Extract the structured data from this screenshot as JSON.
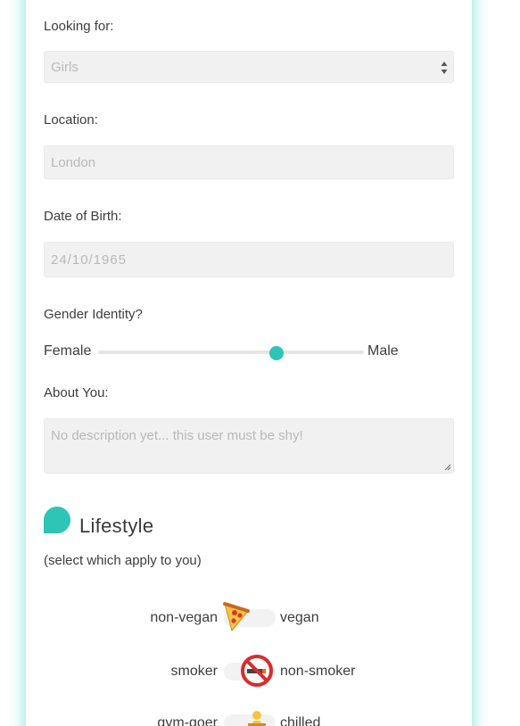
{
  "form": {
    "looking_for": {
      "label": "Looking for:",
      "value": "Girls"
    },
    "location": {
      "label": "Location:",
      "placeholder": "London"
    },
    "dob": {
      "label": "Date of Birth:",
      "placeholder": "24/10/1965"
    },
    "gender": {
      "label": "Gender Identity?",
      "left": "Female",
      "right": "Male",
      "value_fraction": 0.67
    },
    "about": {
      "label": "About You:",
      "placeholder": "No description yet... this user must be shy!"
    }
  },
  "lifestyle": {
    "title": "Lifestyle",
    "subtitle": "(select which apply to you)",
    "toggles": [
      {
        "left": "non-vegan",
        "right": "vegan",
        "icon": "pizza-icon",
        "state": "left"
      },
      {
        "left": "smoker",
        "right": "non-smoker",
        "icon": "no-smoking-icon",
        "state": "right"
      },
      {
        "left": "gym-goer",
        "right": "chilled",
        "icon": "person-icon",
        "state": "right"
      }
    ]
  },
  "colors": {
    "accent": "#2ec4b6",
    "glow": "#3cd7c3",
    "field_bg": "#f1f1f1"
  }
}
